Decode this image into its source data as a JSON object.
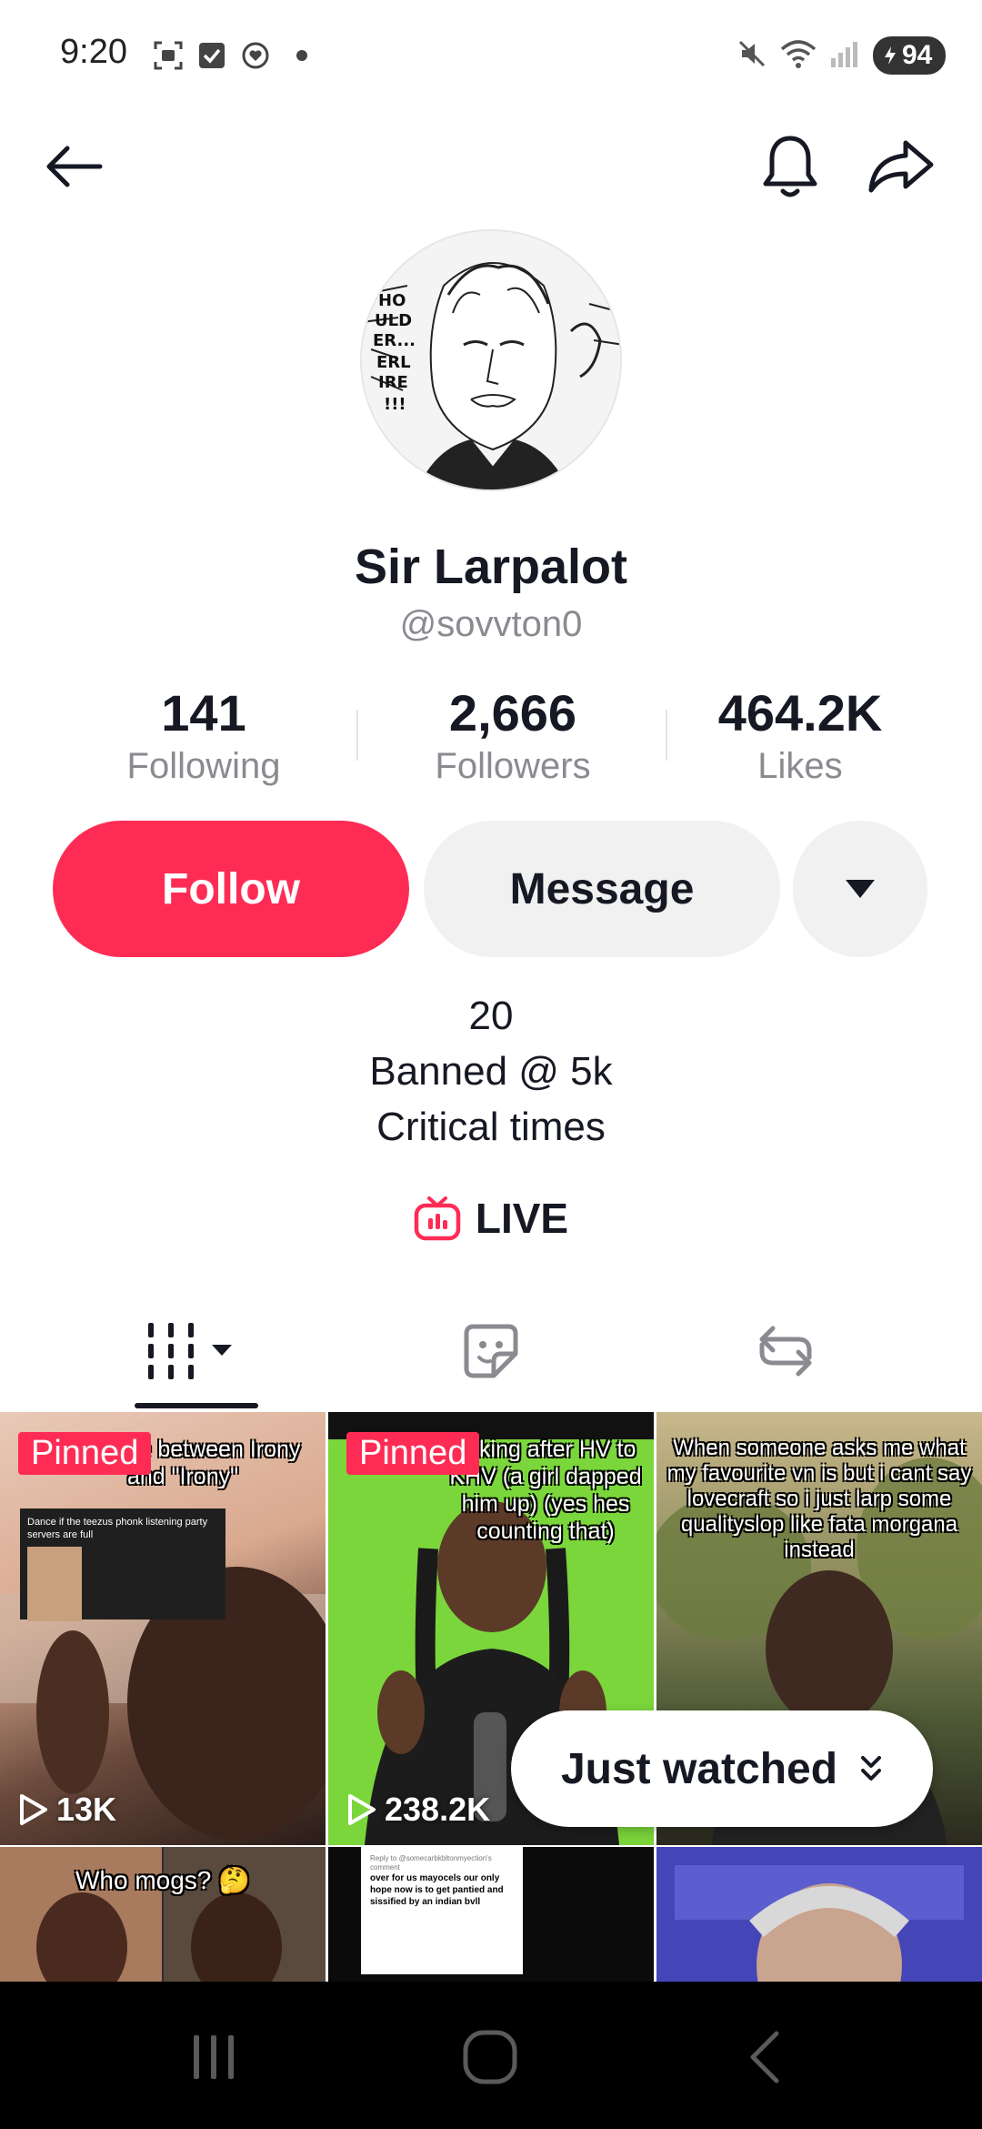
{
  "status_bar": {
    "time": "9:20",
    "battery": "94",
    "icons_left": [
      "screenshot-icon",
      "checkbox-icon",
      "heart-chat-icon",
      "dot-icon"
    ],
    "icons_right": [
      "mute-icon",
      "wifi-icon",
      "signal-icon",
      "battery-icon"
    ]
  },
  "header": {
    "back_icon": "arrow-left-icon",
    "bell_icon": "bell-icon",
    "share_icon": "share-icon"
  },
  "profile": {
    "name": "Sir Larpalot",
    "handle": "@sovvton0"
  },
  "stats": [
    {
      "value": "141",
      "label": "Following"
    },
    {
      "value": "2,666",
      "label": "Followers"
    },
    {
      "value": "464.2K",
      "label": "Likes"
    }
  ],
  "actions": {
    "follow_label": "Follow",
    "message_label": "Message",
    "more_icon": "caret-down-icon"
  },
  "bio": {
    "line1": "20",
    "line2": "Banned @ 5k",
    "line3": "Critical times"
  },
  "live": {
    "label": "LIVE",
    "icon": "tv-live-icon"
  },
  "tabs": [
    {
      "name": "videos",
      "icon": "grid-bars-icon"
    },
    {
      "name": "stickers",
      "icon": "sticker-icon"
    },
    {
      "name": "reposts",
      "icon": "repost-icon"
    }
  ],
  "videos": [
    {
      "pinned": "Pinned",
      "overlay": "ce between Irony and \"Irony\"",
      "caption": "Dance if the teezus phonk listening party servers are full",
      "views": "13K"
    },
    {
      "pinned": "Pinned",
      "overlay": "talking after HV to KHV (a girl dapped him up) (yes hes counting that)",
      "views": "238.2K"
    },
    {
      "overlay": "When someone asks me what my favourite vn is but i cant say lovecraft so i just larp some qualityslop like fata morgana instead"
    },
    {
      "overlay": "Who mogs? 🤔"
    },
    {
      "comment_header": "Reply to @somecarbkbltonmyection's comment",
      "comment": "over for us mayocels our only hope now is to get pantied and sissified by an indian bvll"
    },
    {}
  ],
  "just_watched": {
    "label": "Just watched",
    "icon": "double-chevron-down-icon"
  },
  "colors": {
    "accent": "#fe2c55",
    "secondary_button": "#f1f1f2",
    "muted_text": "#8a8b91",
    "text": "#161823"
  }
}
